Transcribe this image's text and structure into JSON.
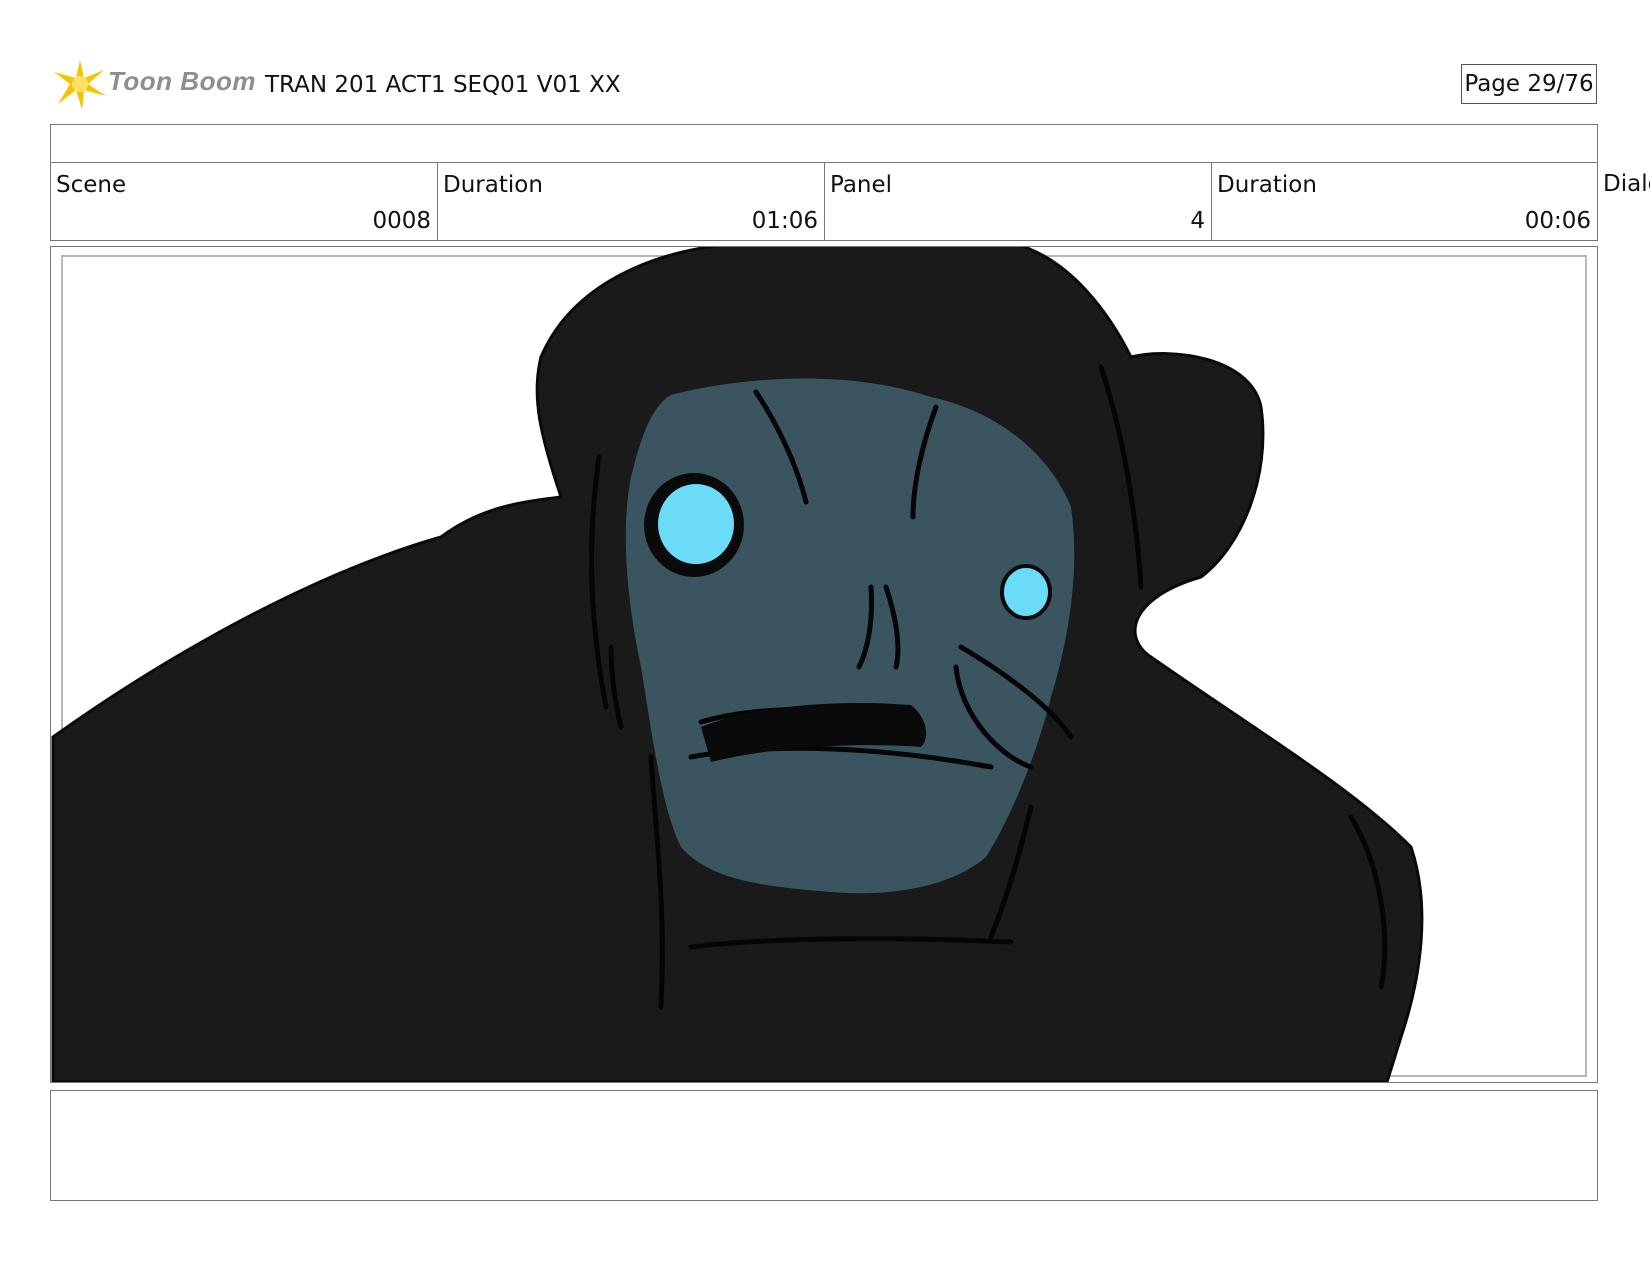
{
  "logo": {
    "brand": "Toon Boom"
  },
  "header": {
    "title": "TRAN 201 ACT1 SEQ01 V01 XX",
    "page": "Page 29/76"
  },
  "info": {
    "scene_label": "Scene",
    "scene_value": "0008",
    "scene_duration_label": "Duration",
    "scene_duration_value": "01:06",
    "panel_label": "Panel",
    "panel_value": "4",
    "panel_duration_label": "Duration",
    "panel_duration_value": "00:06",
    "dialog_label": "Dialo"
  },
  "colors": {
    "creature_body": "#1a1a1a",
    "creature_face": "#3a5560",
    "eye_glow": "#6bdcf7",
    "logo_burst": "#f5c400"
  },
  "icons": {
    "logo": "starburst-icon"
  }
}
